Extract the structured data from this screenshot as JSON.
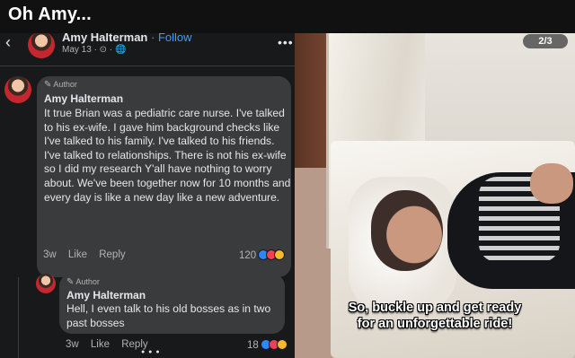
{
  "page_title": "Oh Amy...",
  "post": {
    "author": "Amy Halterman",
    "separator": "·",
    "follow": "Follow",
    "date": "May 13 · ⊙ · 🌐",
    "more": "•••",
    "back": "‹"
  },
  "comments": [
    {
      "badge": "Author",
      "name": "Amy Halterman",
      "text": "It true Brian was a pediatric care nurse. I've talked to his ex-wife. I gave him background checks like I've talked to his family. I've talked to his friends. I've talked to relationships. There is not his ex-wife so I did my research Y'all have nothing to worry about. We've been together now for 10 months and every day is like a new day like a new adventure.",
      "time": "3w",
      "like": "Like",
      "reply": "Reply",
      "reaction_count": "120"
    },
    {
      "badge": "Author",
      "name": "Amy Halterman",
      "text": "Hell, I even talk to his old bosses as in two past bosses",
      "time": "3w",
      "like": "Like",
      "reply": "Reply",
      "reaction_count": "18"
    }
  ],
  "media": {
    "counter": "2/3",
    "caption_line1": "So, buckle up and get ready",
    "caption_line2": "for an unforgettable ride!"
  },
  "icons": {
    "back": "chevron-left-icon",
    "more": "more-dots-icon",
    "pen": "pencil-icon",
    "like": "like-reaction-icon",
    "love": "love-reaction-icon",
    "haha": "haha-reaction-icon"
  },
  "colors": {
    "background": "#18191a",
    "bubble": "#3a3b3c",
    "follow": "#4599ff",
    "like": "#2d88ff",
    "love": "#f33e58",
    "haha": "#f7b928"
  }
}
